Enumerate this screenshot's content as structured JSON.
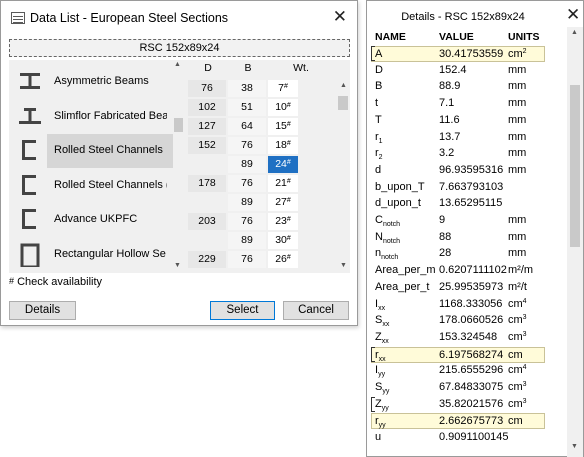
{
  "list_dialog": {
    "title": "Data List - European Steel Sections",
    "close_glyph": "✕",
    "selection_text": "RSC 152x89x24",
    "categories": [
      {
        "label": "Asymmetric Beams",
        "icon": "i-beam-icon"
      },
      {
        "label": "Slimflor Fabricated Bea",
        "icon": "slimflor-beam-icon"
      },
      {
        "label": "Rolled Steel Channels",
        "icon": "channel-icon"
      },
      {
        "label": "Rolled Steel Channels (",
        "icon": "channel-icon"
      },
      {
        "label": "Advance UKPFC",
        "icon": "channel-icon"
      },
      {
        "label": "Rectangular Hollow Se",
        "icon": "hollow-section-icon"
      }
    ],
    "selected_category": "Rolled Steel Channels",
    "columns": [
      "D",
      "B",
      "Wt."
    ],
    "rows": [
      {
        "d": "76",
        "b": "38",
        "wt": "7",
        "mark": "#"
      },
      {
        "d": "102",
        "b": "51",
        "wt": "10",
        "mark": "#"
      },
      {
        "d": "127",
        "b": "64",
        "wt": "15",
        "mark": "#"
      },
      {
        "d": "152",
        "b": "76",
        "wt": "18",
        "mark": "#"
      },
      {
        "d": "",
        "b": "89",
        "wt": "24",
        "mark": "#"
      },
      {
        "d": "178",
        "b": "76",
        "wt": "21",
        "mark": "#"
      },
      {
        "d": "",
        "b": "89",
        "wt": "27",
        "mark": "#"
      },
      {
        "d": "203",
        "b": "76",
        "wt": "23",
        "mark": "#"
      },
      {
        "d": "",
        "b": "89",
        "wt": "30",
        "mark": "#"
      },
      {
        "d": "229",
        "b": "76",
        "wt": "26",
        "mark": "#"
      }
    ],
    "selected_row": 4,
    "note_mark": "#",
    "note_text": " Check availability",
    "buttons": {
      "details": "Details",
      "select": "Select",
      "cancel": "Cancel"
    }
  },
  "details_panel": {
    "title": "Details - RSC 152x89x24",
    "close_glyph": "✕",
    "headers": {
      "name": "NAME",
      "value": "VALUE",
      "units": "UNITS"
    },
    "rows": [
      {
        "name": "A",
        "sub": "",
        "value": "30.41753559",
        "unit": "cm",
        "sup": "2",
        "hl": true,
        "mark": true
      },
      {
        "name": "D",
        "sub": "",
        "value": "152.4",
        "unit": "mm",
        "sup": "",
        "hl": false,
        "mark": false
      },
      {
        "name": "B",
        "sub": "",
        "value": "88.9",
        "unit": "mm",
        "sup": "",
        "hl": false,
        "mark": false
      },
      {
        "name": "t",
        "sub": "",
        "value": "7.1",
        "unit": "mm",
        "sup": "",
        "hl": false,
        "mark": false
      },
      {
        "name": "T",
        "sub": "",
        "value": "11.6",
        "unit": "mm",
        "sup": "",
        "hl": false,
        "mark": false
      },
      {
        "name": "r",
        "sub": "1",
        "value": "13.7",
        "unit": "mm",
        "sup": "",
        "hl": false,
        "mark": false
      },
      {
        "name": "r",
        "sub": "2",
        "value": "3.2",
        "unit": "mm",
        "sup": "",
        "hl": false,
        "mark": false
      },
      {
        "name": "d",
        "sub": "",
        "value": "96.93595316",
        "unit": "mm",
        "sup": "",
        "hl": false,
        "mark": false
      },
      {
        "name": "b_upon_T",
        "sub": "",
        "value": "7.663793103",
        "unit": "",
        "sup": "",
        "hl": false,
        "mark": false
      },
      {
        "name": "d_upon_t",
        "sub": "",
        "value": "13.65295115",
        "unit": "",
        "sup": "",
        "hl": false,
        "mark": false
      },
      {
        "name": "C",
        "sub": "notch",
        "value": "9",
        "unit": "mm",
        "sup": "",
        "hl": false,
        "mark": false
      },
      {
        "name": "N",
        "sub": "notch",
        "value": "88",
        "unit": "mm",
        "sup": "",
        "hl": false,
        "mark": false
      },
      {
        "name": "n",
        "sub": "notch",
        "value": "28",
        "unit": "mm",
        "sup": "",
        "hl": false,
        "mark": false
      },
      {
        "name": "Area_per_m",
        "sub": "",
        "value": "0.6207111102",
        "unit": "m²/m",
        "sup": "",
        "hl": false,
        "mark": false
      },
      {
        "name": "Area_per_t",
        "sub": "",
        "value": "25.99535973",
        "unit": "m²/t",
        "sup": "",
        "hl": false,
        "mark": false
      },
      {
        "name": "I",
        "sub": "xx",
        "value": "1168.333056",
        "unit": "cm",
        "sup": "4",
        "hl": false,
        "mark": false
      },
      {
        "name": "S",
        "sub": "xx",
        "value": "178.0660526",
        "unit": "cm",
        "sup": "3",
        "hl": false,
        "mark": false
      },
      {
        "name": "Z",
        "sub": "xx",
        "value": "153.324548",
        "unit": "cm",
        "sup": "3",
        "hl": false,
        "mark": false
      },
      {
        "name": "r",
        "sub": "xx",
        "value": "6.197568274",
        "unit": "cm",
        "sup": "",
        "hl": true,
        "mark": true
      },
      {
        "name": "I",
        "sub": "yy",
        "value": "215.6555296",
        "unit": "cm",
        "sup": "4",
        "hl": false,
        "mark": false
      },
      {
        "name": "S",
        "sub": "yy",
        "value": "67.84833075",
        "unit": "cm",
        "sup": "3",
        "hl": false,
        "mark": false
      },
      {
        "name": "Z",
        "sub": "yy",
        "value": "35.82021576",
        "unit": "cm",
        "sup": "3",
        "hl": false,
        "mark": true
      },
      {
        "name": "r",
        "sub": "yy",
        "value": "2.662675773",
        "unit": "cm",
        "sup": "",
        "hl": true,
        "mark": false
      },
      {
        "name": "u",
        "sub": "",
        "value": "0.9091100145",
        "unit": "",
        "sup": "",
        "hl": false,
        "mark": false
      }
    ]
  },
  "colors": {
    "selection": "#1f70c3",
    "highlight": "#fffbd9",
    "button_accent": "#0078d7"
  }
}
